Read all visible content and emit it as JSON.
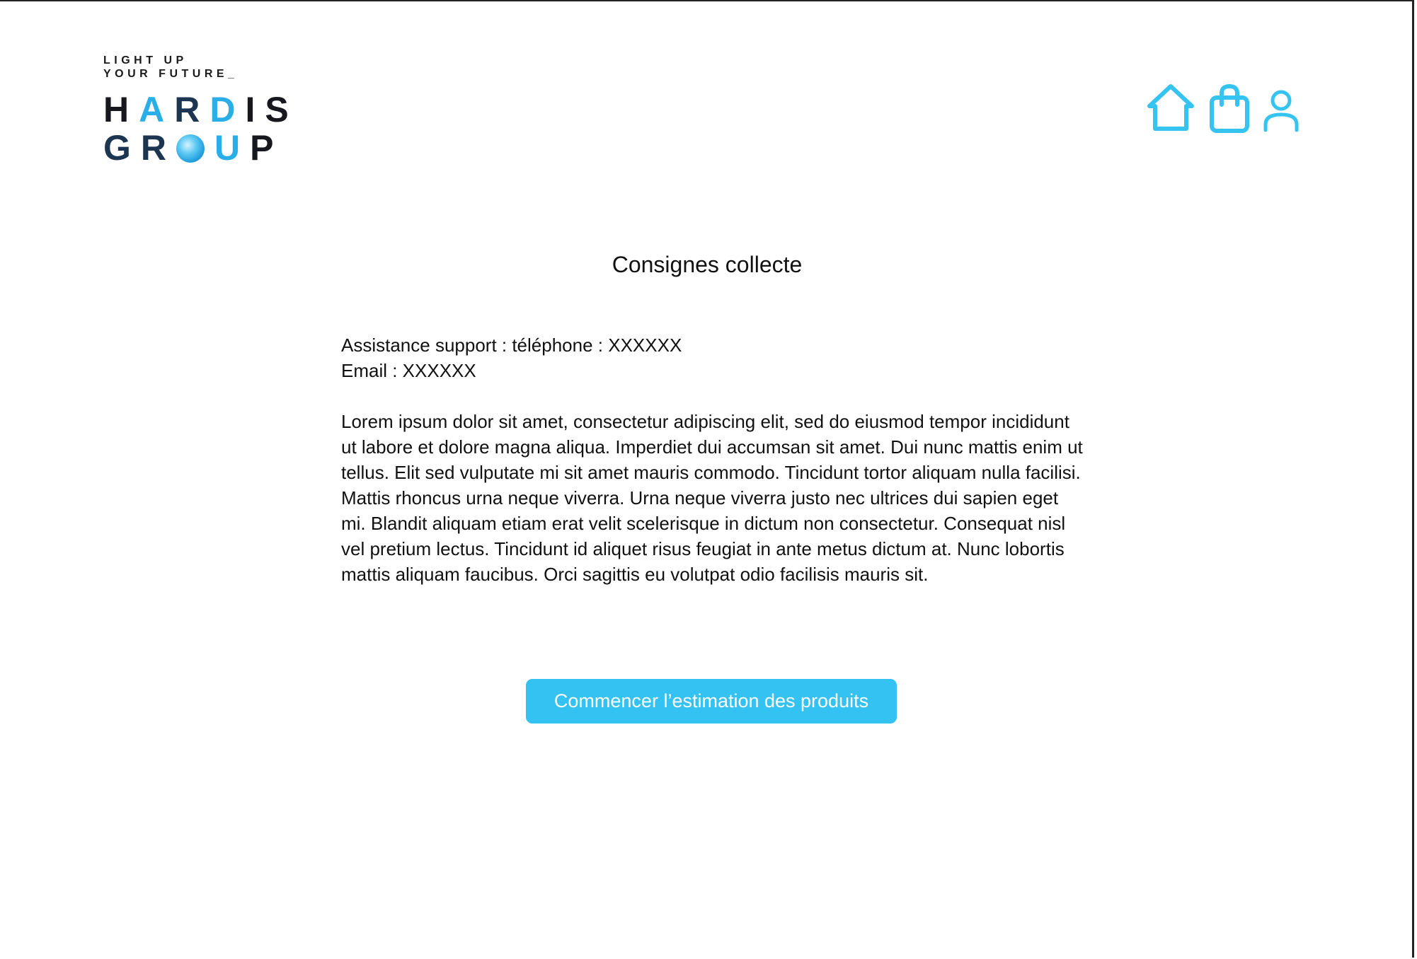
{
  "logo": {
    "tagline_line1": "LIGHT UP",
    "tagline_line2": "YOUR FUTURE_",
    "brand_line1": "HARDIS",
    "brand_line2": "GROUP"
  },
  "nav": {
    "icons": [
      "home-icon",
      "shopping-bag-icon",
      "user-icon"
    ]
  },
  "colors": {
    "accent": "#34c2f2",
    "icon": "#35c3f1"
  },
  "page": {
    "title": "Consignes collecte",
    "support_phone": "Assistance support : téléphone : XXXXXX",
    "support_email": "Email : XXXXXX",
    "body_text": "Lorem ipsum dolor sit amet, consectetur adipiscing elit, sed do eiusmod tempor incididunt ut labore et dolore magna aliqua. Imperdiet dui accumsan sit amet. Dui nunc mattis enim ut tellus. Elit sed vulputate mi sit amet mauris commodo. Tincidunt tortor aliquam nulla facilisi. Mattis rhoncus urna neque viverra. Urna neque viverra justo nec ultrices dui sapien eget mi. Blandit aliquam etiam erat velit scelerisque in dictum non consectetur. Consequat nisl vel pretium lectus. Tincidunt id aliquet risus feugiat in ante metus dictum at. Nunc lobortis mattis aliquam faucibus. Orci sagittis eu volutpat odio facilisis mauris sit.",
    "cta_label": "Commencer l’estimation des produits"
  }
}
